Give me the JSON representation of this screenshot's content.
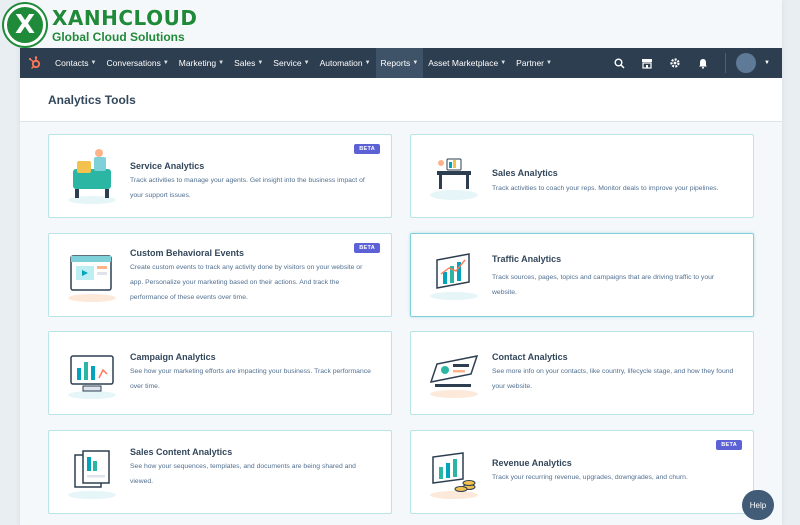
{
  "brand": {
    "mark": "X",
    "name": "XANHCLOUD",
    "tagline": "Global Cloud Solutions"
  },
  "nav": {
    "items": [
      {
        "label": "Contacts"
      },
      {
        "label": "Conversations"
      },
      {
        "label": "Marketing"
      },
      {
        "label": "Sales"
      },
      {
        "label": "Service"
      },
      {
        "label": "Automation"
      },
      {
        "label": "Reports"
      },
      {
        "label": "Asset Marketplace"
      },
      {
        "label": "Partner"
      }
    ],
    "active": "Reports",
    "chevron": "▼"
  },
  "page": {
    "title": "Analytics Tools"
  },
  "cards": [
    {
      "title": "Service Analytics",
      "beta": "BETA",
      "desc": "Track activities to manage your agents. Get insight into the business impact of your support issues."
    },
    {
      "title": "Sales Analytics",
      "beta": "",
      "desc": "Track activities to coach your reps. Monitor deals to improve your pipelines."
    },
    {
      "title": "Custom Behavioral Events",
      "beta": "BETA",
      "desc": "Create custom events to track any activity done by visitors on your website or app. Personalize your marketing based on their actions. And track the performance of these events over time."
    },
    {
      "title": "Traffic Analytics",
      "beta": "",
      "desc": "Track sources, pages, topics and campaigns that are driving traffic to your website."
    },
    {
      "title": "Campaign Analytics",
      "beta": "",
      "desc": "See how your marketing efforts are impacting your business. Track performance over time."
    },
    {
      "title": "Contact Analytics",
      "beta": "",
      "desc": "See more info on your contacts, like country, lifecycle stage, and how they found your website."
    },
    {
      "title": "Sales Content Analytics",
      "beta": "",
      "desc": "See how your sequences, templates, and documents are being shared and viewed."
    },
    {
      "title": "Revenue Analytics",
      "beta": "BETA",
      "desc": "Track your recurring revenue, upgrades, downgrades, and churn."
    }
  ],
  "help": {
    "label": "Help"
  },
  "colors": {
    "nav_bg": "#2d3e50",
    "accent": "#00a4bd",
    "beta": "#5c62d6",
    "brand_green": "#1f8a3a"
  }
}
